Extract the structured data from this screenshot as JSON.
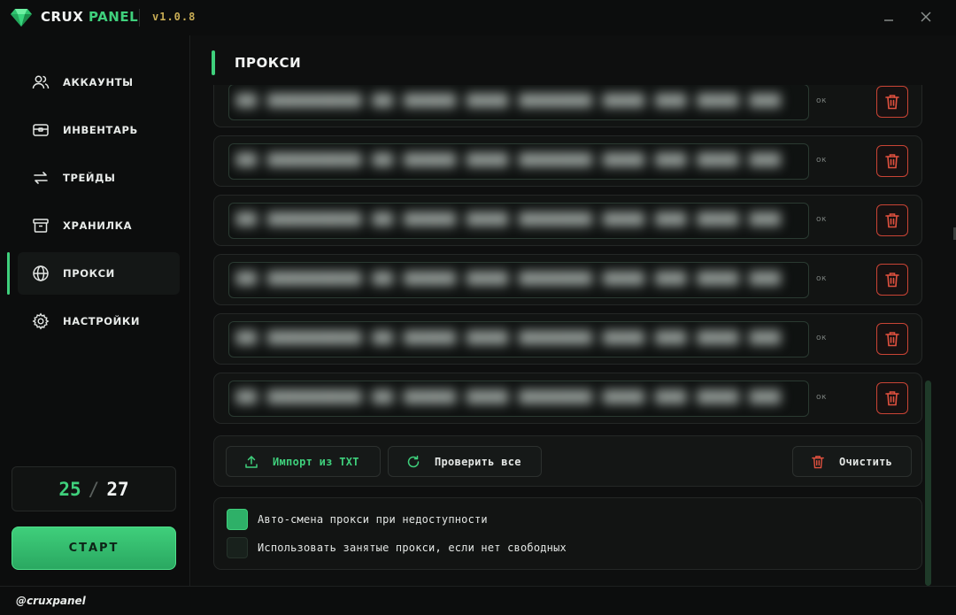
{
  "app": {
    "brand_primary": "CRUX",
    "brand_accent": "PANEL",
    "version": "v1.0.8",
    "footer_handle": "@cruxpanel",
    "accent_color": "#3fd07c",
    "danger_color": "#c94435"
  },
  "window": {
    "minimize_icon": "minimize-icon",
    "close_icon": "close-icon"
  },
  "sidebar": {
    "items": [
      {
        "label": "АККАУНТЫ",
        "icon": "users-icon",
        "active": false
      },
      {
        "label": "ИНВЕНТАРЬ",
        "icon": "inventory-icon",
        "active": false
      },
      {
        "label": "ТРЕЙДЫ",
        "icon": "swap-arrows-icon",
        "active": false
      },
      {
        "label": "ХРАНИЛКА",
        "icon": "archive-box-icon",
        "active": false
      },
      {
        "label": "ПРОКСИ",
        "icon": "globe-icon",
        "active": true
      },
      {
        "label": "НАСТРОЙКИ",
        "icon": "gear-icon",
        "active": false
      }
    ],
    "counter": {
      "current": "25",
      "separator": "/",
      "total": "27"
    },
    "start_label": "СТАРТ"
  },
  "main": {
    "title": "ПРОКСИ",
    "proxies": [
      {
        "status": "ок"
      },
      {
        "status": "ок"
      },
      {
        "status": "ок"
      },
      {
        "status": "ок"
      },
      {
        "status": "ок"
      },
      {
        "status": "ок"
      }
    ],
    "actions": {
      "import_label": "Импорт из TXT",
      "check_label": "Проверить все",
      "clear_label": "Очистить"
    },
    "options": [
      {
        "label": "Авто-смена прокси при недоступности",
        "checked": true
      },
      {
        "label": "Использовать занятые прокси, если нет свободных",
        "checked": false
      }
    ]
  }
}
